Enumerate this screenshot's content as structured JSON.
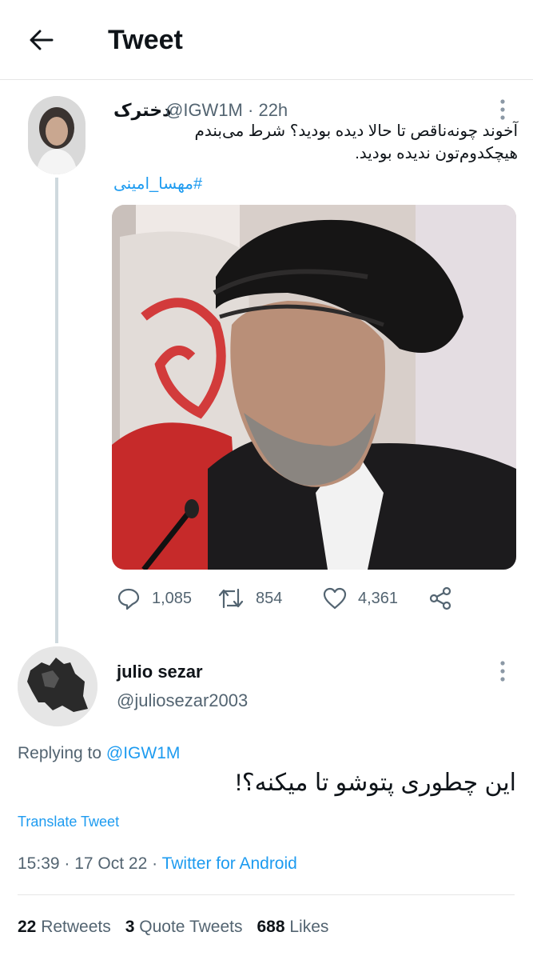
{
  "header": {
    "title": "Tweet",
    "back_icon": "arrow-left-icon"
  },
  "tweet": {
    "display_name": "دخترک",
    "handle": "@IGW1M",
    "time_ago": "22h",
    "text_line1": "آخوند چونه‌ناقص تا حالا دیده بودید؟ شرط می‌بندم",
    "text_line2": "هیچکدوم‌تون ندیده بودید.",
    "hashtag": "#مهسا_امینی",
    "replies": "1,085",
    "retweets": "854",
    "likes": "4,361"
  },
  "reply": {
    "display_name": "julio sezar",
    "handle": "@juliosezar2003",
    "replying_prefix": "Replying to",
    "replying_to": "@IGW1M",
    "text": "این چطوری پتوشو تا میکنه؟!",
    "translate_label": "Translate Tweet",
    "time": "15:39",
    "date": "17 Oct 22",
    "source": "Twitter for Android",
    "retweets_count": "22",
    "retweets_label": "Retweets",
    "quotes_count": "3",
    "quotes_label": "Quote Tweets",
    "likes_count": "688",
    "likes_label": "Likes"
  },
  "colors": {
    "accent": "#1d9bf0",
    "secondary_text": "#536471",
    "primary_text": "#0f1419",
    "thread_line": "#cfd9de"
  }
}
